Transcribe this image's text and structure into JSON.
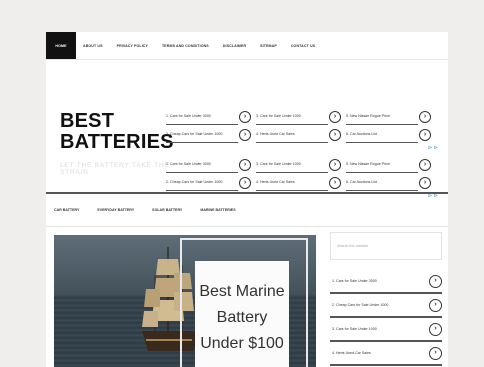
{
  "nav": {
    "items": [
      {
        "label": "Home"
      },
      {
        "label": "About Us"
      },
      {
        "label": "Privacy Policy"
      },
      {
        "label": "Terms and Conditions"
      },
      {
        "label": "Disclaimer"
      },
      {
        "label": "Sitemap"
      },
      {
        "label": "Contact Us"
      }
    ]
  },
  "header": {
    "logo_line1": "BEST",
    "logo_line2": "BATTERIES",
    "tagline": "LET THE BATTERY TAKE THE STRAIN",
    "link_rows": [
      [
        {
          "num": "1.",
          "text": "Cars for Sale Under 3000"
        },
        {
          "num": "3.",
          "text": "Cars for Sale Under 1000"
        },
        {
          "num": "5.",
          "text": "New Nissan Rogue Price"
        },
        {
          "num": "2.",
          "text": "Cheap Cars for Sale Under 1000"
        },
        {
          "num": "4.",
          "text": "Herts Used Car Sales"
        },
        {
          "num": "6.",
          "text": "Car Auctions List"
        }
      ],
      [
        {
          "num": "1.",
          "text": "Cars for Sale Under 3000"
        },
        {
          "num": "3.",
          "text": "Cars for Sale Under 1000"
        },
        {
          "num": "5.",
          "text": "New Nissan Rogue Price"
        },
        {
          "num": "2.",
          "text": "Cheap Cars for Sale Under 1000"
        },
        {
          "num": "4.",
          "text": "Herts Used Car Sales"
        },
        {
          "num": "6.",
          "text": "Car Auctions List"
        }
      ]
    ],
    "more_label": "⊳ ⊳",
    "arrow_glyph": "›"
  },
  "categories": [
    "Car Battery",
    "Everyday Battery",
    "Solar Battery",
    "Marine Batteries"
  ],
  "hero": {
    "title": "Best Marine Battery Under $100"
  },
  "sidebar": {
    "search_placeholder": "Search this website",
    "links": [
      {
        "num": "1.",
        "text": "Cars for Sale Under 3000"
      },
      {
        "num": "2.",
        "text": "Cheap Cars for Sale Under 1000"
      },
      {
        "num": "3.",
        "text": "Cars for Sale Under 1000"
      },
      {
        "num": "4.",
        "text": "Herts Used Car Sales"
      }
    ]
  }
}
